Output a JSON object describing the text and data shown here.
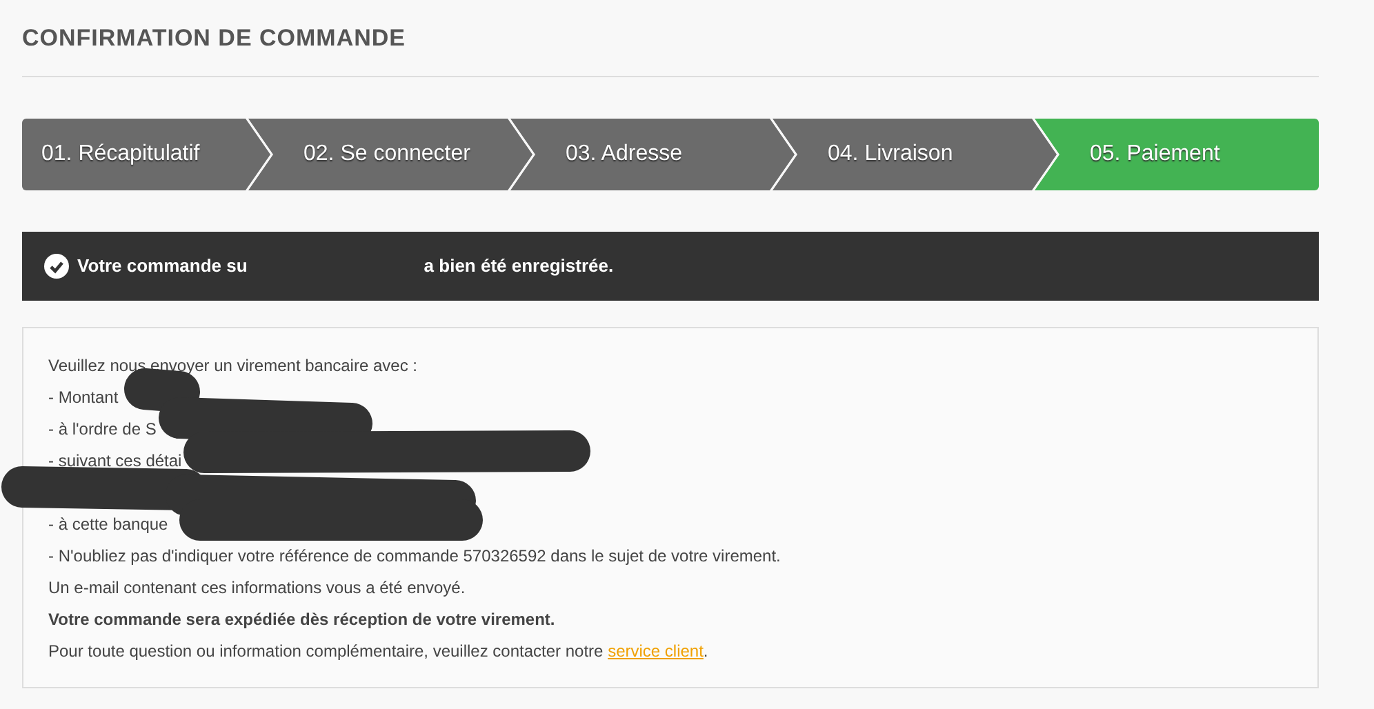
{
  "title": "CONFIRMATION DE COMMANDE",
  "steps": [
    {
      "label": "01. Récapitulatif",
      "selected": false
    },
    {
      "label": "02. Se connecter",
      "selected": false
    },
    {
      "label": "03. Adresse",
      "selected": false
    },
    {
      "label": "04. Livraison",
      "selected": false
    },
    {
      "label": "05. Paiement",
      "selected": true
    }
  ],
  "banner": {
    "text_before": "Votre commande su",
    "text_after": "a bien été enregistrée."
  },
  "instructions": {
    "redacted": true,
    "lines": [
      {
        "kind": "plain",
        "text": "Veuillez nous envoyer un virement bancaire avec :"
      },
      {
        "kind": "plain",
        "text": "- Montant"
      },
      {
        "kind": "plain",
        "text": "- à l'ordre de S"
      },
      {
        "kind": "plain",
        "text": "- suivant ces détai"
      },
      {
        "kind": "blank"
      },
      {
        "kind": "plain",
        "text": "- à cette banque"
      },
      {
        "kind": "plain",
        "text": "- N'oubliez pas d'indiquer votre référence de commande 570326592 dans le sujet de votre virement."
      },
      {
        "kind": "plain",
        "text": "Un e-mail contenant ces informations vous a été envoyé."
      },
      {
        "kind": "bold",
        "text": "Votre commande sera expédiée dès réception de votre virement."
      },
      {
        "kind": "link",
        "text": "Pour toute question ou information complémentaire, veuillez contacter notre ",
        "link": "service client",
        "after": "."
      }
    ]
  }
}
